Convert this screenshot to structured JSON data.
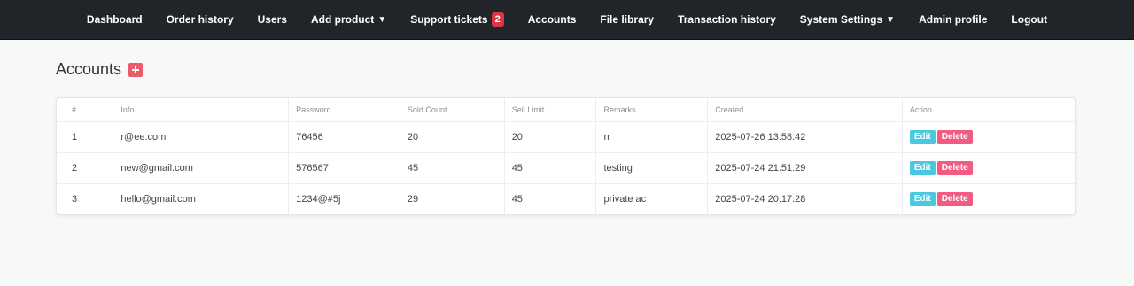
{
  "nav": {
    "items": [
      {
        "label": "Dashboard",
        "name": "nav-dashboard"
      },
      {
        "label": "Order history",
        "name": "nav-order-history"
      },
      {
        "label": "Users",
        "name": "nav-users"
      },
      {
        "label": "Add product",
        "name": "nav-add-product",
        "dropdown": true
      },
      {
        "label": "Support tickets",
        "name": "nav-support-tickets",
        "badge": "2"
      },
      {
        "label": "Accounts",
        "name": "nav-accounts"
      },
      {
        "label": "File library",
        "name": "nav-file-library"
      },
      {
        "label": "Transaction history",
        "name": "nav-transaction-history"
      },
      {
        "label": "System Settings",
        "name": "nav-system-settings",
        "dropdown": true
      },
      {
        "label": "Admin profile",
        "name": "nav-admin-profile"
      },
      {
        "label": "Logout",
        "name": "nav-logout"
      }
    ],
    "dropdown_glyph": "▼"
  },
  "page": {
    "title": "Accounts"
  },
  "table": {
    "columns": [
      "#",
      "Info",
      "Password",
      "Sold Count",
      "Sell Limit",
      "Remarks",
      "Created",
      "Action"
    ],
    "rows": [
      {
        "num": "1",
        "info": "r@ee.com",
        "password": "76456",
        "sold": "20",
        "limit": "20",
        "remarks": "rr",
        "created": "2025-07-26 13:58:42"
      },
      {
        "num": "2",
        "info": "new@gmail.com",
        "password": "576567",
        "sold": "45",
        "limit": "45",
        "remarks": "testing",
        "created": "2025-07-24 21:51:29"
      },
      {
        "num": "3",
        "info": "hello@gmail.com",
        "password": "1234@#5j",
        "sold": "29",
        "limit": "45",
        "remarks": "private ac",
        "created": "2025-07-24 20:17:28"
      }
    ],
    "edit_label": "Edit",
    "delete_label": "Delete"
  },
  "colors": {
    "navbar": "#212529",
    "badge": "#dc3545",
    "add_button": "#ec5b6a",
    "edit_button": "#48c9e0",
    "delete_button": "#f25c82"
  }
}
